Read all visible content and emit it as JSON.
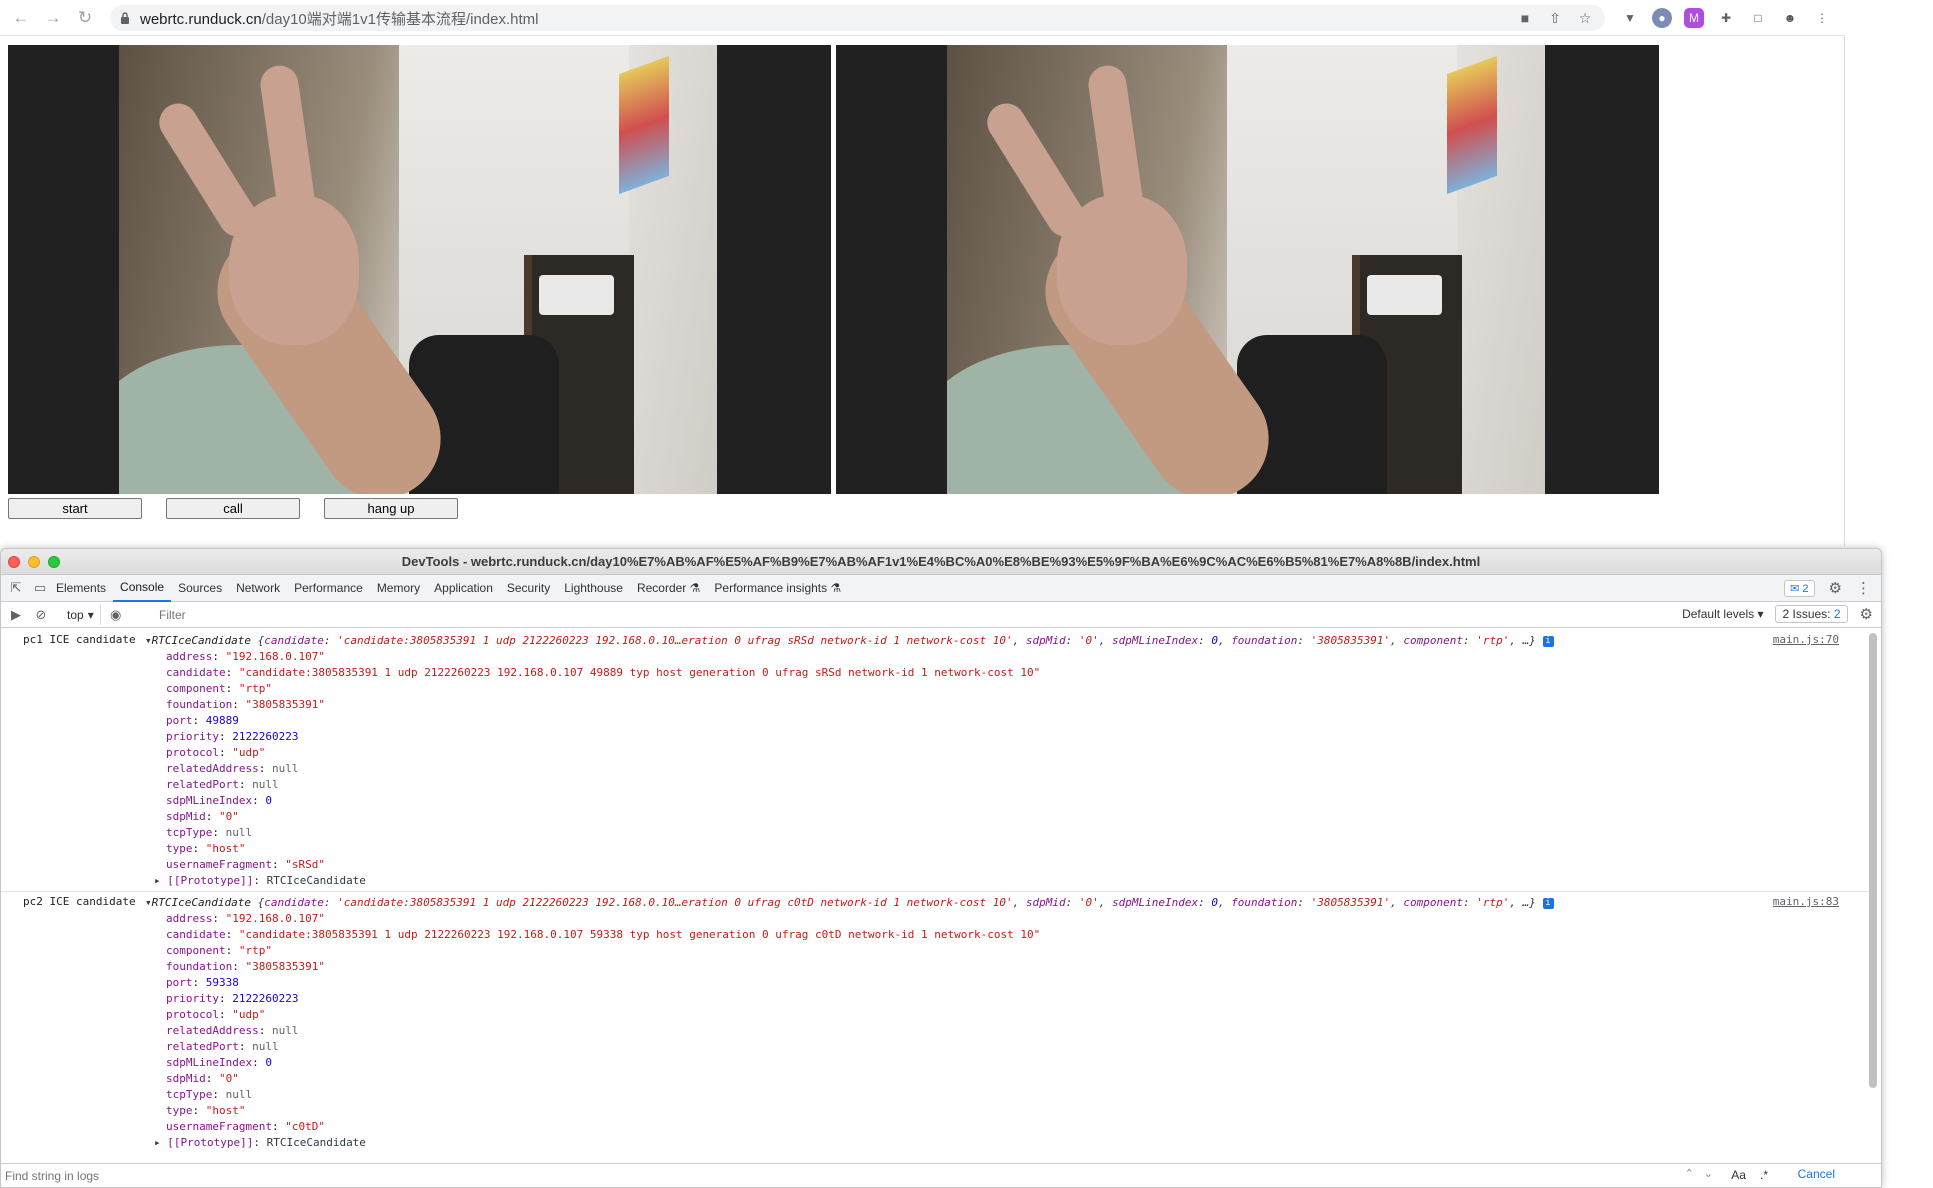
{
  "browser": {
    "url_host": "webrtc.runduck.cn",
    "url_path": "/day10端对端1v1传输基本流程/index.html"
  },
  "page": {
    "buttons": {
      "start": "start",
      "call": "call",
      "hangup": "hang up"
    }
  },
  "devtools": {
    "title": "DevTools - webrtc.runduck.cn/day10%E7%AB%AF%E5%AF%B9%E7%AB%AF1v1%E4%BC%A0%E8%BE%93%E5%9F%BA%E6%9C%AC%E6%B5%81%E7%A8%8B/index.html",
    "tabs": [
      "Elements",
      "Console",
      "Sources",
      "Network",
      "Performance",
      "Memory",
      "Application",
      "Security",
      "Lighthouse",
      "Recorder ⚗",
      "Performance insights ⚗"
    ],
    "issues_badge": "2",
    "context": "top",
    "filter_placeholder": "Filter",
    "default_levels": "Default levels ▾",
    "issues_label": "2 Issues:",
    "issues_count": "2",
    "find_placeholder": "Find string in logs",
    "find_aa": "Aa",
    "find_regex": ".*",
    "cancel": "Cancel"
  },
  "console": {
    "entries": [
      {
        "prefix": "pc1 ICE candidate",
        "objname": "RTCIceCandidate",
        "summary_candidate": "'candidate:3805835391 1 udp 2122260223 192.168.0.10…eration 0 ufrag sRSd network-id 1 network-cost 10'",
        "summary_sdpmid": "'0'",
        "summary_index": "0",
        "summary_foundation": "'3805835391'",
        "summary_component": "'rtp'",
        "src": "main.js:70",
        "props": {
          "address": "\"192.168.0.107\"",
          "candidate": "\"candidate:3805835391 1 udp 2122260223 192.168.0.107 49889 typ host generation 0 ufrag sRSd network-id 1 network-cost 10\"",
          "component": "\"rtp\"",
          "foundation": "\"3805835391\"",
          "port": "49889",
          "priority": "2122260223",
          "protocol": "\"udp\"",
          "relatedAddress": "null",
          "relatedPort": "null",
          "sdpMLineIndex": "0",
          "sdpMid": "\"0\"",
          "tcpType": "null",
          "type": "\"host\"",
          "usernameFragment": "\"sRSd\""
        },
        "proto": "RTCIceCandidate"
      },
      {
        "prefix": "pc2 ICE candidate",
        "objname": "RTCIceCandidate",
        "summary_candidate": "'candidate:3805835391 1 udp 2122260223 192.168.0.10…eration 0 ufrag c0tD network-id 1 network-cost 10'",
        "summary_sdpmid": "'0'",
        "summary_index": "0",
        "summary_foundation": "'3805835391'",
        "summary_component": "'rtp'",
        "src": "main.js:83",
        "props": {
          "address": "\"192.168.0.107\"",
          "candidate": "\"candidate:3805835391 1 udp 2122260223 192.168.0.107 59338 typ host generation 0 ufrag c0tD network-id 1 network-cost 10\"",
          "component": "\"rtp\"",
          "foundation": "\"3805835391\"",
          "port": "59338",
          "priority": "2122260223",
          "protocol": "\"udp\"",
          "relatedAddress": "null",
          "relatedPort": "null",
          "sdpMLineIndex": "0",
          "sdpMid": "\"0\"",
          "tcpType": "null",
          "type": "\"host\"",
          "usernameFragment": "\"c0tD\""
        },
        "proto": "RTCIceCandidate"
      }
    ]
  },
  "colors": {
    "accent": "#1a73e8",
    "string": "#c41a16",
    "key": "#881391",
    "number": "#1c00cf"
  }
}
